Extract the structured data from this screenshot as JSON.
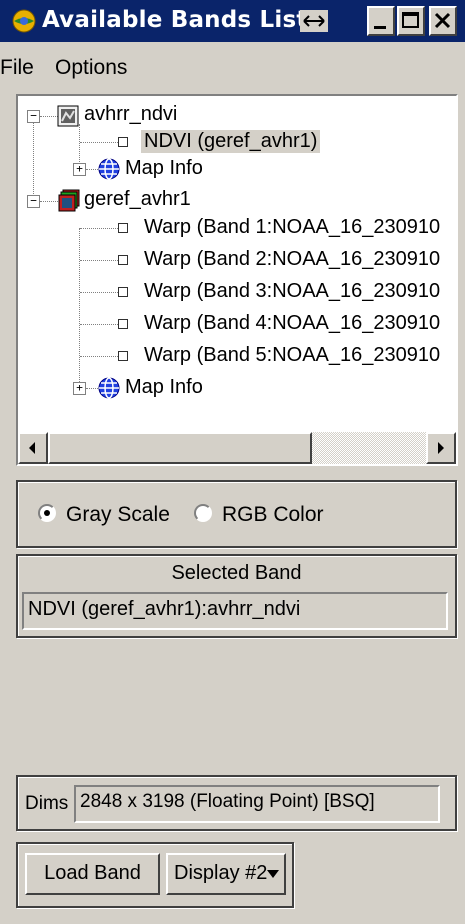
{
  "window": {
    "title": "Available Bands List",
    "title_bar_color": "#0a246a",
    "resize_icon": "double-arrow-icon",
    "buttons": [
      "minimize",
      "maximize",
      "close"
    ]
  },
  "menu": {
    "items": [
      "File",
      "Options"
    ]
  },
  "tree": {
    "files": [
      {
        "name": "avhrr_ndvi",
        "icon": "image-file-icon",
        "expanded": true,
        "bands": [
          {
            "label": "NDVI (geref_avhr1)",
            "selected": true
          }
        ],
        "map_info": "Map Info"
      },
      {
        "name": "geref_avhr1",
        "icon": "multiband-file-icon",
        "expanded": true,
        "bands": [
          {
            "label": "Warp (Band 1:NOAA_16_230910",
            "selected": false
          },
          {
            "label": "Warp (Band 2:NOAA_16_230910",
            "selected": false
          },
          {
            "label": "Warp (Band 3:NOAA_16_230910",
            "selected": false
          },
          {
            "label": "Warp (Band 4:NOAA_16_230910",
            "selected": false
          },
          {
            "label": "Warp (Band 5:NOAA_16_230910",
            "selected": false
          }
        ],
        "map_info": "Map Info"
      }
    ]
  },
  "color_mode": {
    "options": [
      "Gray Scale",
      "RGB Color"
    ],
    "selected": "Gray Scale"
  },
  "selected_band": {
    "heading": "Selected Band",
    "value": "NDVI (geref_avhr1):avhrr_ndvi"
  },
  "dims": {
    "label": "Dims",
    "value": "2848 x 3198 (Floating Point) [BSQ]"
  },
  "actions": {
    "load_band": "Load Band",
    "display": "Display #2"
  }
}
